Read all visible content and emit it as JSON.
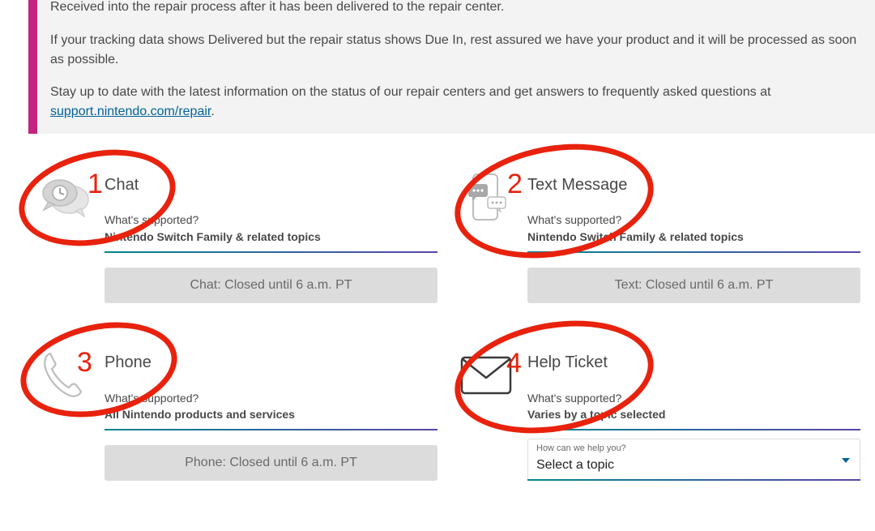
{
  "notice": {
    "p1": "Received into the repair process after it has been delivered to the repair center.",
    "p2": "If your tracking data shows Delivered but the repair status shows Due In, rest assured we have your product and it will be processed as soon as possible.",
    "p3_text": "Stay up to date with the latest information on the status of our repair centers and get answers to frequently asked questions at",
    "p3_link": "support.nintendo.com/repair",
    "p3_end": ".",
    "accent_color": "#c4247d",
    "link_color": "#00629b"
  },
  "cards": {
    "chat": {
      "title": "Chat",
      "sup_label": "What's supported?",
      "sup_value": "Nintendo Switch Family & related topics",
      "button_label": "Chat: Closed until 6 a.m. PT",
      "icon": "chat-bubble-clock-icon"
    },
    "text": {
      "title": "Text Message",
      "sup_label": "What's supported?",
      "sup_value": "Nintendo Switch Family & related topics",
      "button_label": "Text: Closed until 6 a.m. PT",
      "icon": "phone-message-icon"
    },
    "phone": {
      "title": "Phone",
      "sup_label": "What's supported?",
      "sup_value": "All Nintendo products and services",
      "button_label": "Phone: Closed until 6 a.m. PT",
      "icon": "phone-handset-icon"
    },
    "ticket": {
      "title": "Help Ticket",
      "sup_label": "What's supported?",
      "sup_value": "Varies by a topic selected",
      "select_label": "How can we help you?",
      "select_value": "Select a topic",
      "icon": "envelope-icon"
    }
  },
  "annotations": {
    "n1": "1",
    "n2": "2",
    "n3": "3",
    "n4": "4",
    "color": "#e8220d"
  }
}
